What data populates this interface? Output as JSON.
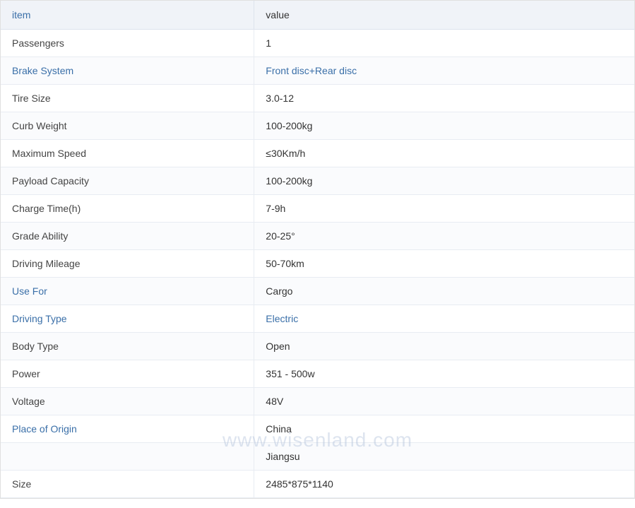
{
  "table": {
    "header": {
      "item_label": "item",
      "value_label": "value"
    },
    "rows": [
      {
        "item": "Passengers",
        "value": "1",
        "item_color": "normal",
        "value_color": "normal"
      },
      {
        "item": "Brake System",
        "value": "Front disc+Rear disc",
        "item_color": "link",
        "value_color": "link"
      },
      {
        "item": "Tire Size",
        "value": "3.0-12",
        "item_color": "normal",
        "value_color": "normal"
      },
      {
        "item": "Curb Weight",
        "value": "100-200kg",
        "item_color": "normal",
        "value_color": "normal"
      },
      {
        "item": "Maximum Speed",
        "value": "≤30Km/h",
        "item_color": "normal",
        "value_color": "normal"
      },
      {
        "item": "Payload Capacity",
        "value": "100-200kg",
        "item_color": "normal",
        "value_color": "normal"
      },
      {
        "item": "Charge Time(h)",
        "value": "7-9h",
        "item_color": "normal",
        "value_color": "normal"
      },
      {
        "item": "Grade Ability",
        "value": "20-25°",
        "item_color": "normal",
        "value_color": "normal"
      },
      {
        "item": "Driving Mileage",
        "value": "50-70km",
        "item_color": "normal",
        "value_color": "normal"
      },
      {
        "item": "Use For",
        "value": "Cargo",
        "item_color": "link",
        "value_color": "normal"
      },
      {
        "item": "Driving Type",
        "value": "Electric",
        "item_color": "link",
        "value_color": "link"
      },
      {
        "item": "Body Type",
        "value": "Open",
        "item_color": "normal",
        "value_color": "normal"
      },
      {
        "item": "Power",
        "value": "351 - 500w",
        "item_color": "normal",
        "value_color": "normal"
      },
      {
        "item": "Voltage",
        "value": "48V",
        "item_color": "normal",
        "value_color": "normal"
      },
      {
        "item": "Place of Origin",
        "value": "China",
        "item_color": "link",
        "value_color": "normal"
      },
      {
        "item": "",
        "value": "Jiangsu",
        "item_color": "normal",
        "value_color": "normal"
      },
      {
        "item": "Size",
        "value": "2485*875*1140",
        "item_color": "normal",
        "value_color": "normal"
      }
    ],
    "watermark": "www.wisenland.com"
  }
}
